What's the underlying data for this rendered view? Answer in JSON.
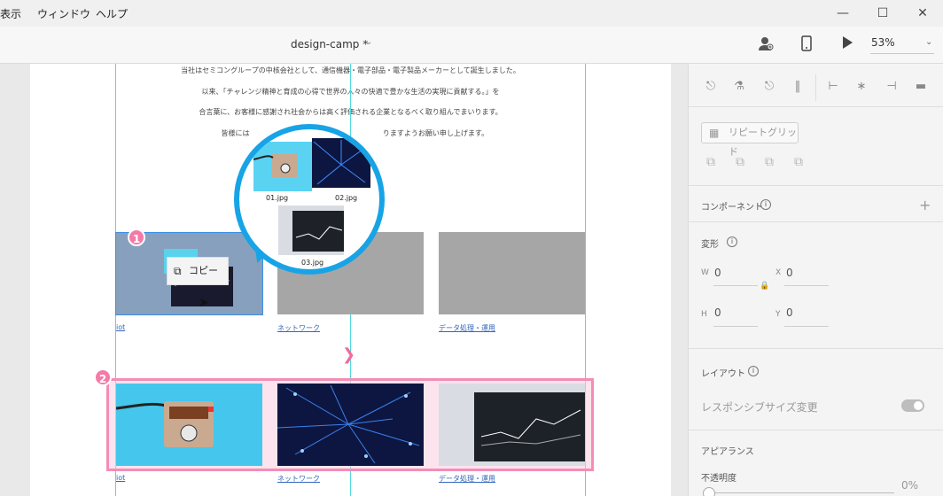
{
  "menubar": {
    "items": [
      "表示",
      "ウィンドウ",
      "ヘルプ"
    ],
    "controls": [
      "minimize-icon",
      "maximize-icon",
      "close-icon"
    ]
  },
  "toolbar": {
    "doc_title": "design-camp",
    "doc_modified": "*",
    "zoom": "53%"
  },
  "artboard": {
    "paragraphs": [
      "当社はセミコングループの中核会社として、通信機器・電子部品・電子製品メーカーとして誕生しました。",
      "以来、「チャレンジ精神と育成の心得で世界の人々の快適で豊かな生活の実現に貢献する。」を",
      "合言葉に、お客様に感謝され社会からは高く評価される企業となるべく取り組んでまいります。",
      "皆様には",
      "りますようお願い申し上げます。"
    ],
    "captions_top": [
      "iot",
      "ネットワーク",
      "データ処理・運用"
    ],
    "captions_bottom": [
      "iot",
      "ネットワーク",
      "データ処理・運用"
    ]
  },
  "callout": {
    "files": [
      "01.jpg",
      "02.jpg",
      "03.jpg"
    ],
    "copy_label": "コピー",
    "badge1": "1",
    "badge2": "2"
  },
  "panel": {
    "repeat_grid": "リピートグリッド",
    "component": "コンポーネント",
    "transform": "変形",
    "w_label": "W",
    "w_value": "0",
    "x_label": "X",
    "x_value": "0",
    "h_label": "H",
    "h_value": "0",
    "y_label": "Y",
    "y_value": "0",
    "layout": "レイアウト",
    "responsive": "レスポンシブサイズ変更",
    "appearance": "アピアランス",
    "opacity_label": "不透明度",
    "opacity_value": "0%"
  },
  "colors": {
    "guide": "#4fd8e0",
    "accent_pink": "#f47aa7",
    "bubble_blue": "#17a4e6",
    "selection_blue": "#3a8ee6"
  }
}
